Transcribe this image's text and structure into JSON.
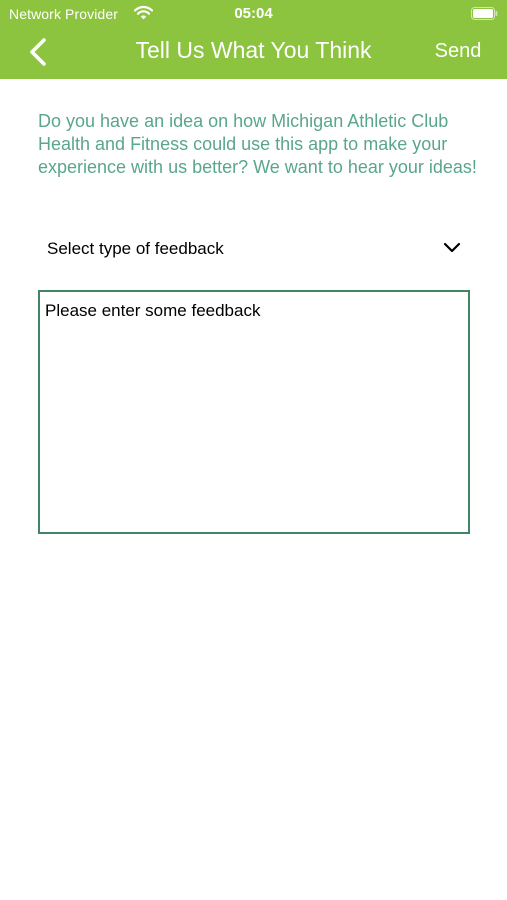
{
  "status_bar": {
    "carrier": "Network Provider",
    "time": "05:04"
  },
  "nav": {
    "title": "Tell Us What You Think",
    "send_label": "Send",
    "background_color": "#8cc43f"
  },
  "content": {
    "intro_text": "Do you have an idea on how Michigan Athletic Club Health and Fitness could use this app to make your experience with us better? We want to hear your ideas!",
    "intro_color": "#5aa68a",
    "feedback_type": {
      "selected": "Select type of feedback"
    },
    "feedback_input": {
      "placeholder": "Please enter some feedback",
      "value": ""
    }
  },
  "icons": {
    "back": "chevron-left-icon",
    "wifi": "wifi-icon",
    "battery": "battery-icon",
    "dropdown": "chevron-down-icon"
  }
}
